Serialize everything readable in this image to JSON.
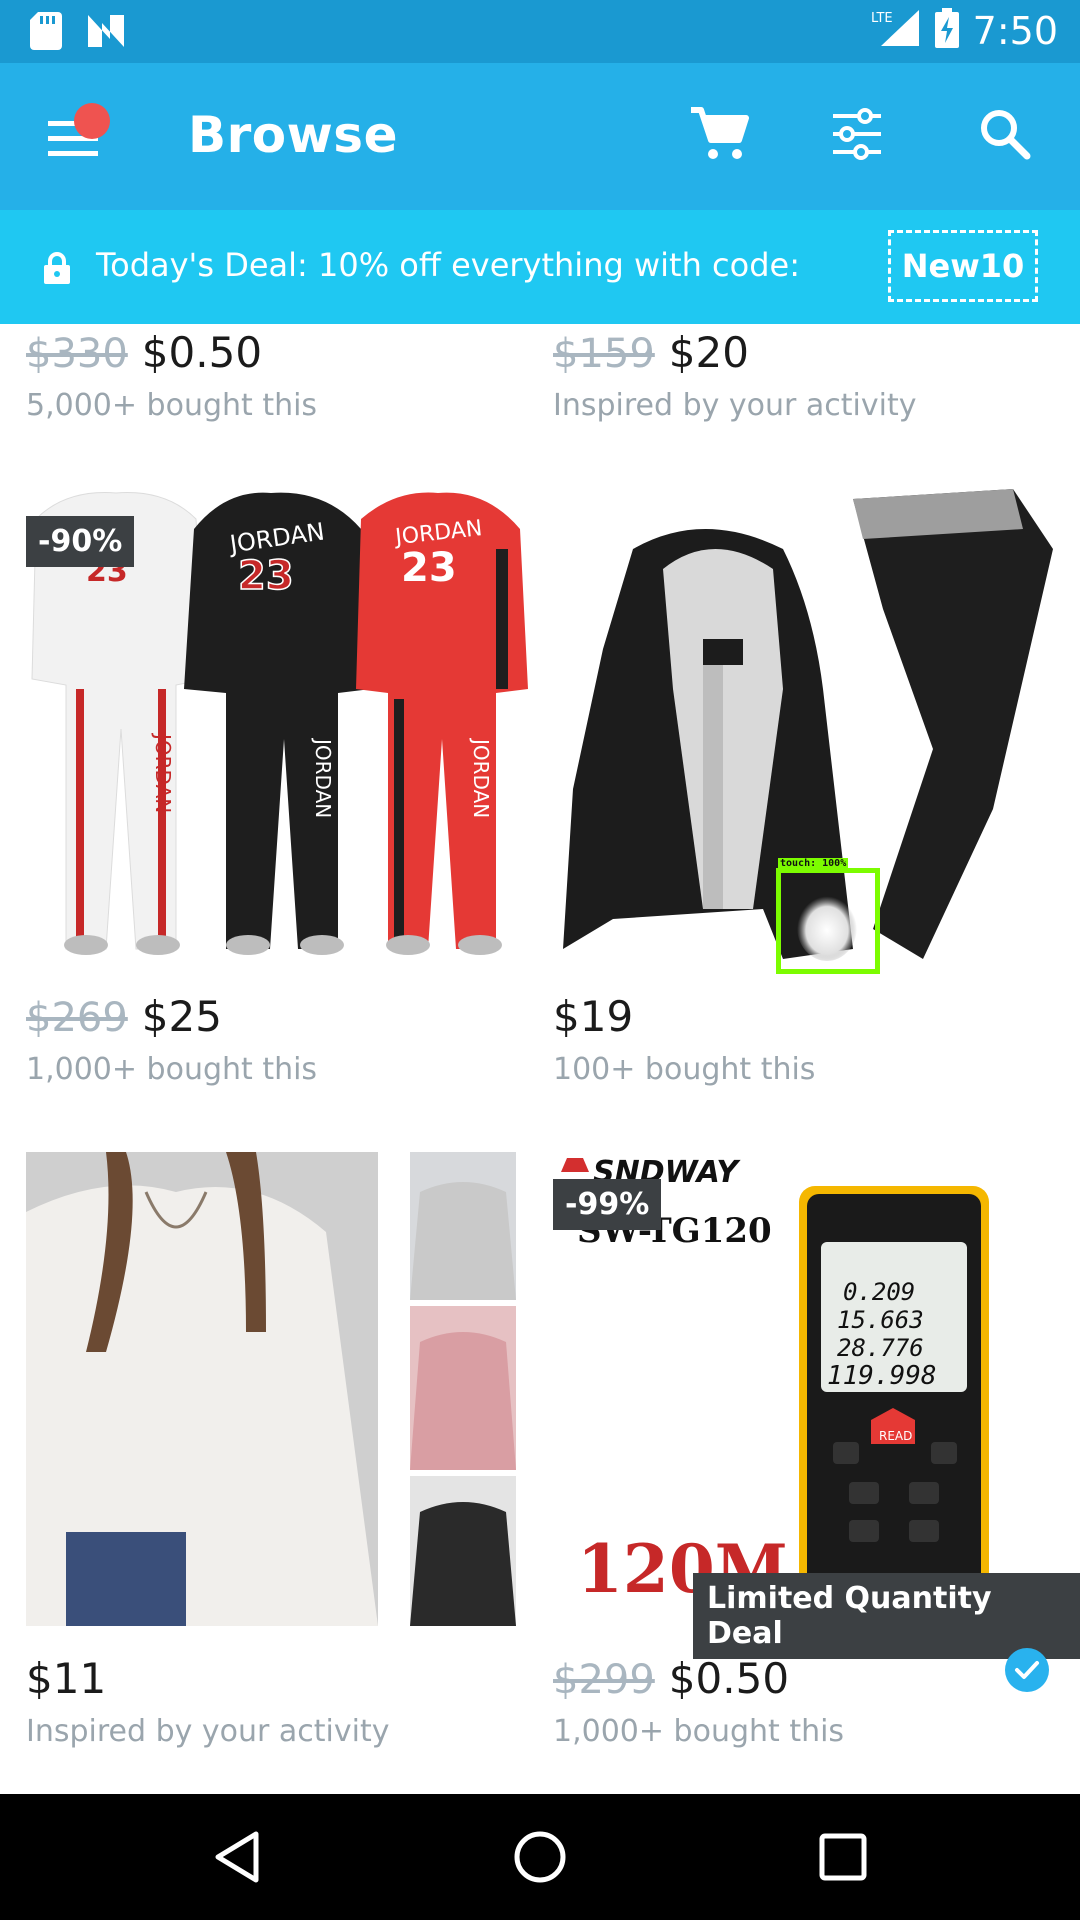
{
  "status_bar": {
    "time": "7:50",
    "network": "LTE"
  },
  "app_bar": {
    "title": "Browse"
  },
  "deal_banner": {
    "text": "Today's Deal: 10% off everything with code:",
    "code": "New10"
  },
  "products": [
    {
      "old_price": "$330",
      "price": "$0.50",
      "subtext": "5,000+ bought this"
    },
    {
      "old_price": "$159",
      "price": "$20",
      "subtext": "Inspired by your activity"
    },
    {
      "badge": "-90%",
      "old_price": "$269",
      "price": "$25",
      "subtext": "1,000+ bought this",
      "image_text": [
        "JORDAN",
        "23"
      ]
    },
    {
      "price": "$19",
      "subtext": "100+ bought this"
    },
    {
      "price": "$11",
      "subtext": "Inspired by your activity"
    },
    {
      "badge": "-99%",
      "old_price": "$299",
      "price": "$0.50",
      "subtext": "1,000+ bought this",
      "label": "Limited Quantity Deal",
      "image_text": {
        "brand": "SNDWAY",
        "model": "SW-TG120",
        "range": "120M",
        "readings": [
          "0.209",
          "15.663",
          "28.776",
          "119.998"
        ],
        "read_button": "READ"
      }
    }
  ],
  "touch_overlay": {
    "label": "touch: 100%"
  },
  "colors": {
    "status_bar": "#1a99d1",
    "app_bar": "#25b0e8",
    "deal_bar": "#1fc8f2",
    "badge": "#3c4043",
    "notification_dot": "#ef5350",
    "touch_box": "#7cfc00"
  }
}
